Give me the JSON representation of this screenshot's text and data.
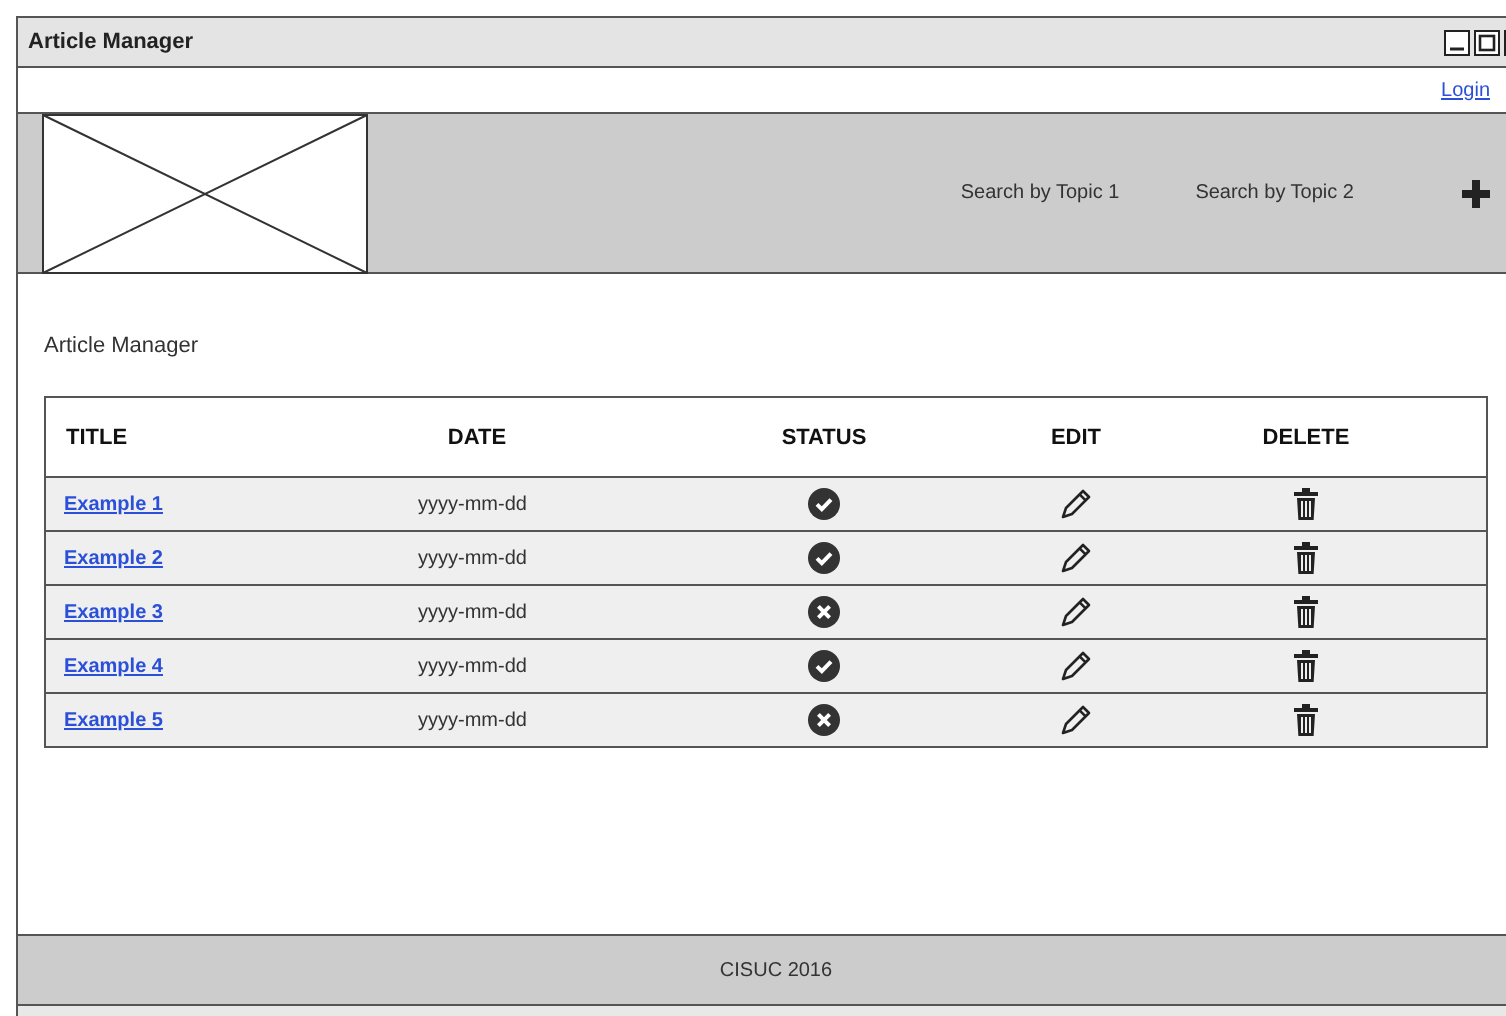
{
  "window": {
    "title": "Article Manager"
  },
  "top_bar": {
    "login": "Login"
  },
  "header": {
    "nav": [
      "Search by Topic 1",
      "Search by Topic 2"
    ]
  },
  "page_title": "Article Manager",
  "table": {
    "columns": [
      "TITLE",
      "DATE",
      "STATUS",
      "EDIT",
      "DELETE"
    ],
    "rows": [
      {
        "title": "Example 1",
        "date": "yyyy-mm-dd",
        "approved": true
      },
      {
        "title": "Example 2",
        "date": "yyyy-mm-dd",
        "approved": true
      },
      {
        "title": "Example 3",
        "date": "yyyy-mm-dd",
        "approved": false
      },
      {
        "title": "Example 4",
        "date": "yyyy-mm-dd",
        "approved": true
      },
      {
        "title": "Example 5",
        "date": "yyyy-mm-dd",
        "approved": false
      }
    ]
  },
  "footer": "CISUC 2016"
}
